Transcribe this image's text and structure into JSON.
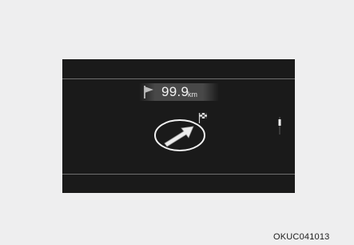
{
  "display": {
    "distance_value": "99.9",
    "distance_unit": "km",
    "start_flag_icon": "flag-icon",
    "turn_icon": "arrow-up-right-icon",
    "destination_flag_icon": "checkered-flag-icon"
  },
  "caption": "OKUC041013",
  "colors": {
    "page_background": "#eeeeef",
    "display_background": "#1a1a1a",
    "text": "#f2f2f2"
  }
}
